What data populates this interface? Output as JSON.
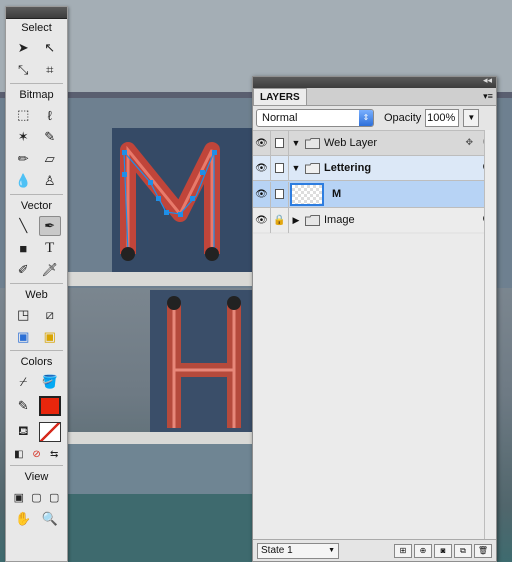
{
  "tools": {
    "sections": {
      "select": "Select",
      "bitmap": "Bitmap",
      "vector": "Vector",
      "web": "Web",
      "colors": "Colors",
      "view": "View"
    },
    "text_tool_glyph": "T",
    "stroke_color": "#2b2b2b",
    "fill_color": "#e8260c"
  },
  "layers_panel": {
    "tab_label": "LAYERS",
    "blend_mode": "Normal",
    "opacity_label": "Opacity",
    "opacity_value": "100%",
    "layers": [
      {
        "name": "Web Layer"
      },
      {
        "name": "Lettering"
      },
      {
        "name": "M"
      },
      {
        "name": "Image"
      }
    ],
    "state_label": "State 1"
  }
}
